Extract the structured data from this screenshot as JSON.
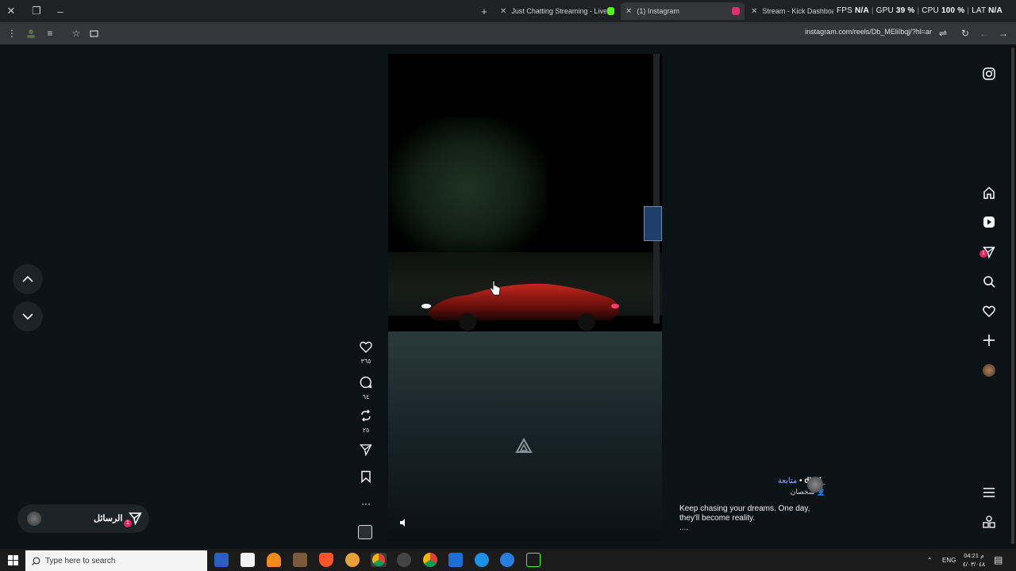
{
  "browser": {
    "tabs": [
      {
        "title": "Just Chatting Streaming - Live",
        "favicon_color": "#53fc18"
      },
      {
        "title": "(1) Instagram",
        "favicon_color": "#e1306c"
      },
      {
        "title": "Stream - Kick Dashboard",
        "favicon_color": "#53fc18"
      }
    ],
    "new_tab_label": "+",
    "url": "instagram.com/reels/Db_MEliIbqj/?hl=ar"
  },
  "overlay": {
    "fps_label": "FPS",
    "fps_value": "N/A",
    "gpu_label": "GPU",
    "gpu_value": "39 %",
    "cpu_label": "CPU",
    "cpu_value": "100 %",
    "lat_label": "LAT",
    "lat_value": "N/A"
  },
  "reel": {
    "actions": {
      "likes": "٣٦٥",
      "comments": "٦٤",
      "reposts": "٢٥"
    },
    "author": {
      "username": "dkof_",
      "follow_label": "متابعة",
      "subtitle": "شخصان"
    },
    "caption": "Keep chasing your dreams. One day, they'll become reality.",
    "caption_more": "...."
  },
  "messages_button": {
    "label": "الرسائل",
    "badge": "1"
  },
  "rail": {
    "messages_badge": "1"
  },
  "taskbar": {
    "search_placeholder": "Type here to search",
    "language": "ENG",
    "time": "04:21 م",
    "date": "٤/٠٣/٠٤٨"
  },
  "colors": {
    "accent_link": "#8aa8ff",
    "notification": "#e0245e",
    "kick_green": "#53fc18"
  }
}
